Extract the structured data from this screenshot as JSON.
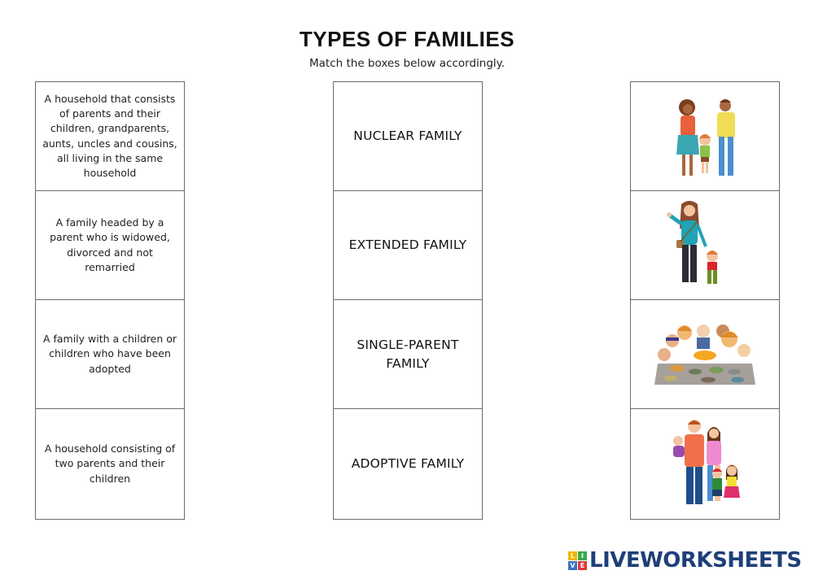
{
  "header": {
    "title": "TYPES OF FAMILIES",
    "subtitle": "Match the boxes below accordingly."
  },
  "descriptions": [
    "A household that consists of parents and their children, grandparents, aunts, uncles and cousins, all living in the same household",
    "A family headed by a parent who is widowed, divorced and not remarried",
    "A family with a children or children who have been adopted",
    "A household consisting of two parents and their children"
  ],
  "family_types": [
    "NUCLEAR FAMILY",
    "EXTENDED FAMILY",
    "SINGLE-PARENT FAMILY",
    "ADOPTIVE FAMILY"
  ],
  "pictures": [
    {
      "icon": "nuclear-family-illustration-icon",
      "alt": "Mother, father and young son holding hands"
    },
    {
      "icon": "single-parent-illustration-icon",
      "alt": "Mother holding hand of young son"
    },
    {
      "icon": "extended-family-dinner-illustration-icon",
      "alt": "Large family gathered around a dinner table"
    },
    {
      "icon": "adoptive-family-illustration-icon",
      "alt": "Parents with baby and two children"
    }
  ],
  "logo": {
    "badge_letters": [
      "L",
      "I",
      "V",
      "E"
    ],
    "badge_colors": [
      "#f2b705",
      "#3aa84a",
      "#3b73c4",
      "#e0373a"
    ],
    "text": "LIVEWORKSHEETS",
    "color": "#1f3f79"
  }
}
